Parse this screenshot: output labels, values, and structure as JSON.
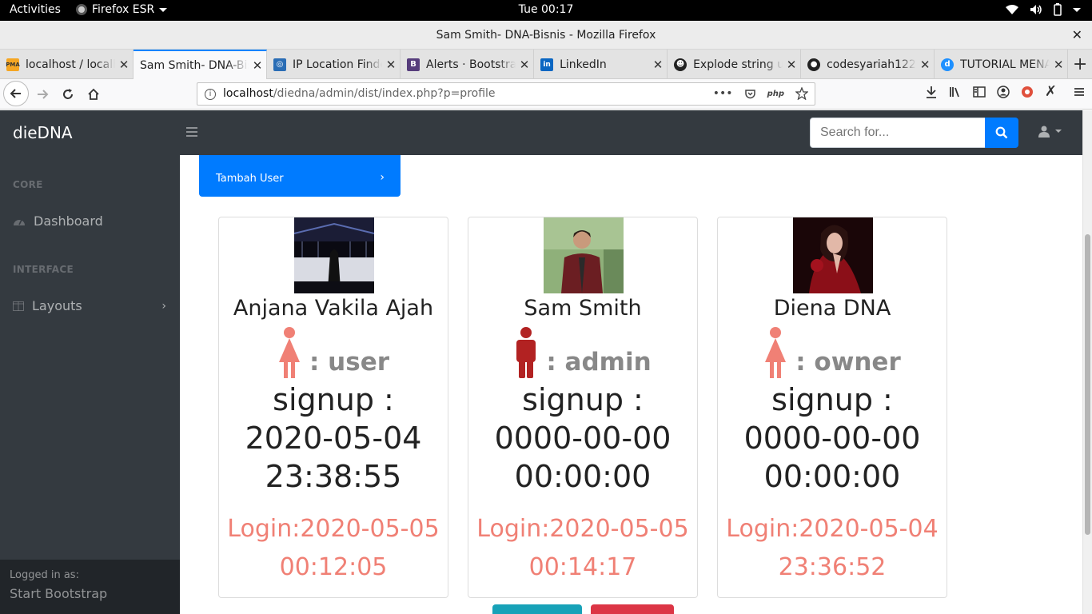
{
  "os": {
    "activities": "Activities",
    "app_name": "Firefox ESR",
    "clock": "Tue 00:17"
  },
  "window": {
    "title": "Sam Smith- DNA-Bisnis - Mozilla Firefox",
    "close_glyph": "✕"
  },
  "tabs": [
    {
      "label": "localhost / localhost",
      "favicon": "pma",
      "active": false
    },
    {
      "label": "Sam Smith- DNA-Bisnis",
      "favicon": "none",
      "active": true
    },
    {
      "label": "IP Location Finder",
      "favicon": "globe",
      "active": false
    },
    {
      "label": "Alerts · Bootstrap",
      "favicon": "B",
      "active": false
    },
    {
      "label": "LinkedIn",
      "favicon": "in",
      "active": false
    },
    {
      "label": "Explode string using",
      "favicon": "mask",
      "active": false
    },
    {
      "label": "codesyariah122",
      "favicon": "github",
      "active": false
    },
    {
      "label": "TUTORIAL MENAMPILKAN",
      "favicon": "d",
      "active": false
    }
  ],
  "url": {
    "host": "localhost",
    "path": "/diedna/admin/dist/index.php?p=profile",
    "dots": "•••"
  },
  "app": {
    "brand": "dieDNA",
    "search_placeholder": "Search for...",
    "sidebar": {
      "core_heading": "CORE",
      "dashboard": "Dashboard",
      "interface_heading": "INTERFACE",
      "layouts": "Layouts",
      "footer_small": "Logged in as:",
      "footer_name": "Start Bootstrap"
    },
    "tambah_user": "Tambah User",
    "users": [
      {
        "name": "Anjana Vakila Ajah",
        "role": ": user",
        "icon_color": "#f08075",
        "signup_label": "signup :",
        "signup_date": "2020-05-04",
        "signup_time": "23:38:55",
        "login_date": "Login:2020-05-05",
        "login_time": "00:12:05"
      },
      {
        "name": "Sam Smith",
        "role": ": admin",
        "icon_color": "#b22222",
        "signup_label": "signup :",
        "signup_date": "0000-00-00",
        "signup_time": "00:00:00",
        "login_date": "Login:2020-05-05",
        "login_time": "00:14:17"
      },
      {
        "name": "Diena DNA",
        "role": ": owner",
        "icon_color": "#f08075",
        "signup_label": "signup :",
        "signup_date": "0000-00-00",
        "signup_time": "00:00:00",
        "login_date": "Login:2020-05-04",
        "login_time": "23:36:52"
      }
    ]
  },
  "colors": {
    "primary": "#007bff",
    "dark": "#343a40",
    "login": "#f08075",
    "info": "#17a2b8",
    "danger": "#dc3545"
  }
}
